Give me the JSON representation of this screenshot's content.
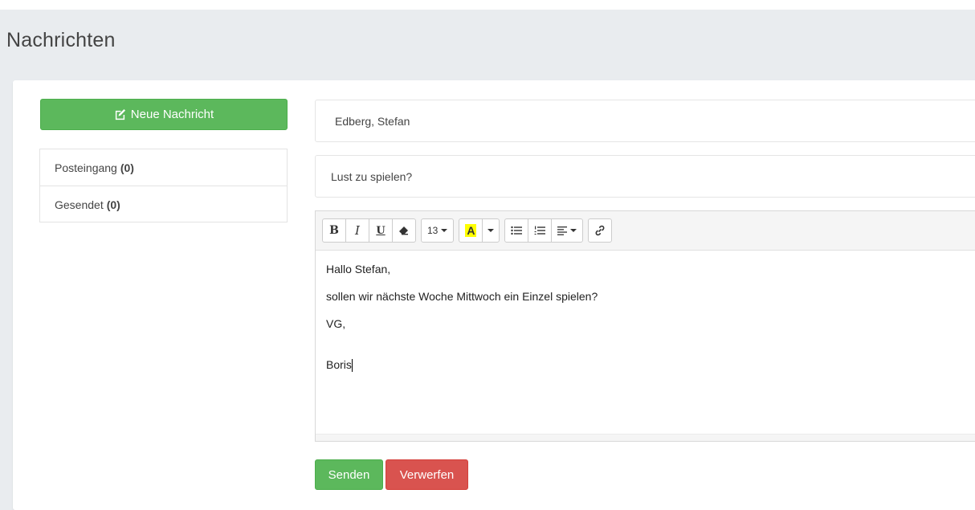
{
  "page": {
    "title": "Nachrichten"
  },
  "sidebar": {
    "new_message_label": "Neue Nachricht",
    "new_message_icon": "edit-icon",
    "folders": [
      {
        "label": "Posteingang",
        "count": "(0)"
      },
      {
        "label": "Gesendet",
        "count": "(0)"
      }
    ]
  },
  "compose": {
    "recipient": "Edberg, Stefan",
    "subject": "Lust zu spielen?",
    "toolbar": {
      "bold": "B",
      "italic": "I",
      "underline": "U",
      "eraser_icon": "eraser-icon",
      "font_size": "13",
      "highlight_letter": "A",
      "unordered_list_icon": "unordered-list-icon",
      "ordered_list_icon": "ordered-list-icon",
      "align_icon": "align-left-icon",
      "link_icon": "link-icon"
    },
    "body_lines": [
      "Hallo Stefan,",
      "sollen wir nächste Woche Mittwoch ein Einzel spielen?",
      "VG,",
      "Boris"
    ],
    "send_label": "Senden",
    "discard_label": "Verwerfen"
  },
  "colors": {
    "success": "#5cb85c",
    "danger": "#d9534f",
    "header_bg": "#e9ecef",
    "highlight": "#ffff00"
  }
}
